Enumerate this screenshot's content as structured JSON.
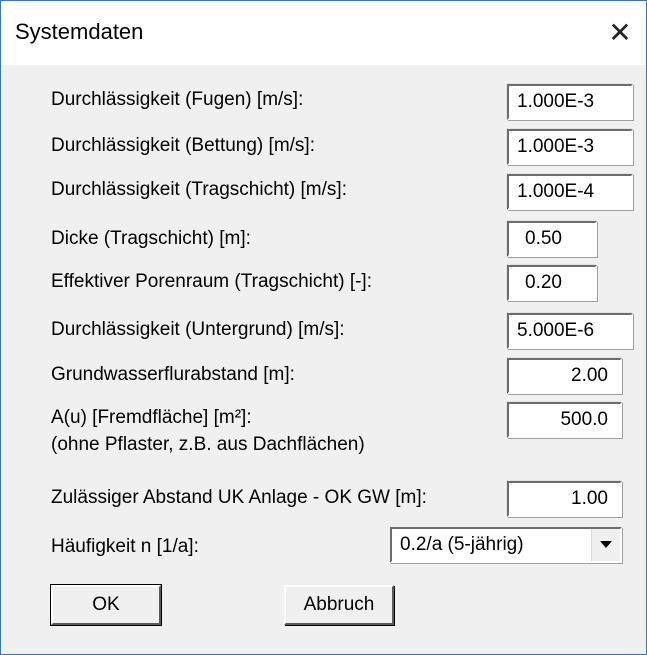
{
  "window": {
    "title": "Systemdaten"
  },
  "icons": {
    "close": "close-icon",
    "dropdown": "chevron-down-icon"
  },
  "colors": {
    "window_border": "#1e7fd4",
    "dialog_background": "#f0f0f0",
    "titlebar_background": "#ffffff"
  },
  "fields": {
    "fugen": {
      "label": "Durchlässigkeit (Fugen) [m/s]:",
      "value": "1.000E-3"
    },
    "bettung": {
      "label": "Durchlässigkeit (Bettung) [m/s]:",
      "value": "1.000E-3"
    },
    "tragschicht": {
      "label": "Durchlässigkeit (Tragschicht) [m/s]:",
      "value": "1.000E-4"
    },
    "dicke": {
      "label": "Dicke (Tragschicht) [m]:",
      "value": "0.50"
    },
    "porenraum": {
      "label": "Effektiver Porenraum (Tragschicht) [-]:",
      "value": "0.20"
    },
    "untergrund": {
      "label": "Durchlässigkeit (Untergrund) [m/s]:",
      "value": "5.000E-6"
    },
    "flurabstand": {
      "label": "Grundwasserflurabstand [m]:",
      "value": "2.00"
    },
    "fremdflaeche": {
      "label": "A(u) [Fremdfläche] [m²]:",
      "note": "(ohne Pflaster, z.B. aus Dachflächen)",
      "value": "500.0"
    },
    "abstand": {
      "label": "Zulässiger Abstand UK Anlage - OK GW [m]:",
      "value": "1.00"
    }
  },
  "haeufigkeit": {
    "label": "Häufigkeit n [1/a]:",
    "selected": "0.2/a (5-jährig)"
  },
  "buttons": {
    "ok": "OK",
    "cancel": "Abbruch"
  }
}
